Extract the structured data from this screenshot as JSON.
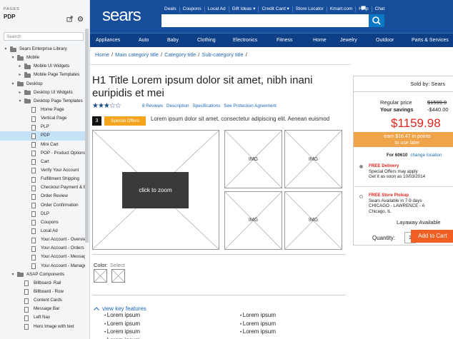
{
  "sidebar": {
    "section_label": "PAGES",
    "page_title": "PDP",
    "search_placeholder": "Search",
    "tree": [
      {
        "label": "Sears Enterprise Library",
        "type": "folder",
        "depth": 0,
        "open": true
      },
      {
        "label": "Mobile",
        "type": "folder",
        "depth": 1,
        "open": true
      },
      {
        "label": "Mobile UI Widgets",
        "type": "folder",
        "depth": 2,
        "open": false
      },
      {
        "label": "Mobile Page Templates",
        "type": "folder",
        "depth": 2,
        "open": false
      },
      {
        "label": "Desktop",
        "type": "folder",
        "depth": 1,
        "open": true
      },
      {
        "label": "Desktop UI Widgets",
        "type": "folder",
        "depth": 2,
        "open": false
      },
      {
        "label": "Desktop Page Templates",
        "type": "folder",
        "depth": 2,
        "open": true
      },
      {
        "label": "Home Page",
        "type": "page",
        "depth": 3
      },
      {
        "label": "Vertical Page",
        "type": "page",
        "depth": 3
      },
      {
        "label": "PLP",
        "type": "page",
        "depth": 3
      },
      {
        "label": "PDP",
        "type": "page",
        "depth": 3,
        "selected": true
      },
      {
        "label": "Mini Cart",
        "type": "page",
        "depth": 3
      },
      {
        "label": "POP - Product Options",
        "type": "page",
        "depth": 3
      },
      {
        "label": "Cart",
        "type": "page",
        "depth": 3
      },
      {
        "label": "Verify Your Account",
        "type": "page",
        "depth": 3
      },
      {
        "label": "Fulfillment Shipping",
        "type": "page",
        "depth": 3
      },
      {
        "label": "Checkout Payment & B",
        "type": "page",
        "depth": 3
      },
      {
        "label": "Order Review",
        "type": "page",
        "depth": 3
      },
      {
        "label": "Order Confirmation",
        "type": "page",
        "depth": 3
      },
      {
        "label": "DLP",
        "type": "page",
        "depth": 3
      },
      {
        "label": "Coupons",
        "type": "page",
        "depth": 3
      },
      {
        "label": "Local Ad",
        "type": "page",
        "depth": 3
      },
      {
        "label": "Your Account - Overvie",
        "type": "page",
        "depth": 3
      },
      {
        "label": "Your Account - Orders",
        "type": "page",
        "depth": 3
      },
      {
        "label": "Your Account - Messag",
        "type": "page",
        "depth": 3
      },
      {
        "label": "Your Account - Manage",
        "type": "page",
        "depth": 3
      },
      {
        "label": "ASAP Components",
        "type": "folder",
        "depth": 1,
        "open": true
      },
      {
        "label": "Billboard- Rail",
        "type": "page",
        "depth": 2
      },
      {
        "label": "Billboard - Row",
        "type": "page",
        "depth": 2
      },
      {
        "label": "Content Cards",
        "type": "page",
        "depth": 2
      },
      {
        "label": "Message Bar",
        "type": "page",
        "depth": 2
      },
      {
        "label": "Left Nav",
        "type": "page",
        "depth": 2
      },
      {
        "label": "Hero Image with text",
        "type": "page",
        "depth": 2
      }
    ]
  },
  "header": {
    "logo": "sears",
    "top_links": [
      "Deals",
      "Coupons",
      "Local Ad",
      "Gift Ideas ▾",
      "Credit Card ▾",
      "Store Locator",
      "Kmart.com",
      "Help",
      "Chat"
    ],
    "nav": [
      "Appliances",
      "Auto",
      "Baby",
      "Clothing",
      "Electronics",
      "Fitness",
      "Home",
      "Jewelry",
      "Outdoor",
      "Parts & Services"
    ]
  },
  "breadcrumb": {
    "items": [
      "Home",
      "Main category title",
      "Category title",
      "Sub-category title"
    ],
    "separator": "/"
  },
  "product": {
    "title": "H1 Title Lorem ipsum dolor sit amet, nibh inani euripidis et mei",
    "stars": "★★★☆☆",
    "rating": 3,
    "rating_max": 5,
    "review_links": [
      "8 Reviews",
      "Description",
      "Specifications",
      "See Protection Agreement"
    ],
    "offer_count": "3",
    "offer_badge": "Special Offers",
    "offer_text": "Lorem ipsum dolor sit amet, consectetur adipiscing elit. Aenean euismod",
    "zoom_label": "click to zoom",
    "thumb_label": "IMG",
    "color_label": "Color:",
    "color_select": "Select",
    "features_title": "view key features",
    "features_left": [
      "Lorem ipsum",
      "Lorem ipsum",
      "Lorem ipsum",
      "Lorem ipsum"
    ],
    "features_right": [
      "Lorem ipsum",
      "Lorem ipsum",
      "Lorem ipsum"
    ]
  },
  "buybox": {
    "sold_by": "Sold by: Sears",
    "regular_label": "Regular price",
    "savings_label": "Your savings",
    "regular_value": "$1599.9",
    "savings_value": "-$440.00",
    "price": "$1159.98",
    "earn_line1": "earn $16.47 in points",
    "earn_line2": "to use later",
    "for_zip": "For 60610",
    "change_location": "change location",
    "delivery_title": "FREE Delivery",
    "delivery_line1": "Special Offers may apply",
    "delivery_line2": "Get it as soon as 10/03/2014",
    "pickup_title": "FREE Store Pickup",
    "pickup_line1": "Sears Available in 7-9 days",
    "pickup_line2": "CHICAGO - LAWRENCE - A",
    "pickup_line3": "Chicago, IL",
    "layaway": "Layaway Available",
    "quantity_label": "Quantity:",
    "quantity_value": "1",
    "add_to_cart": "Add to Cart"
  },
  "colors": {
    "brand_blue": "#164e9c",
    "nav_blue": "#0d3f86",
    "link_blue": "#1f66b9",
    "price_red": "#e3241d",
    "orange": "#f0a44a",
    "cart_orange": "#f25f22",
    "selection": "#c5e2f7"
  }
}
